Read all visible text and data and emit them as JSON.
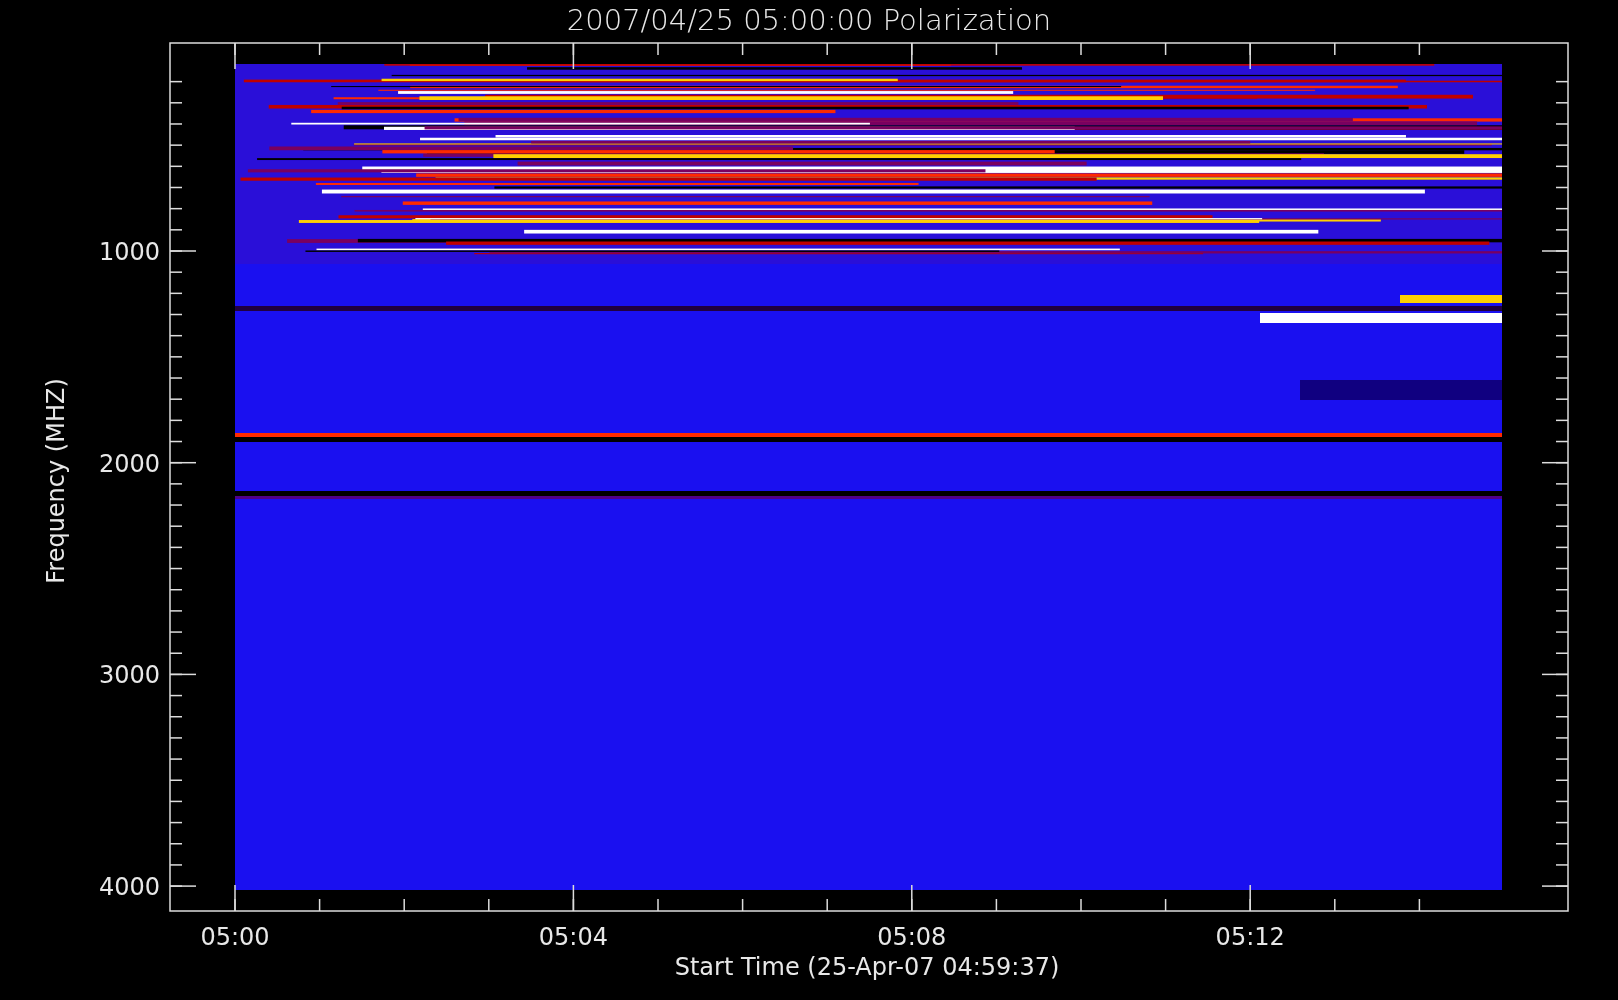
{
  "title": "2007/04/25 05:00:00 Polarization",
  "y_axis": {
    "label": "Frequency (MHZ)",
    "ticks": [
      "1000",
      "2000",
      "3000",
      "4000"
    ]
  },
  "x_axis": {
    "label": "Start Time (25-Apr-07 04:59:37)",
    "ticks": [
      "05:00",
      "05:04",
      "05:08",
      "05:12"
    ]
  }
}
